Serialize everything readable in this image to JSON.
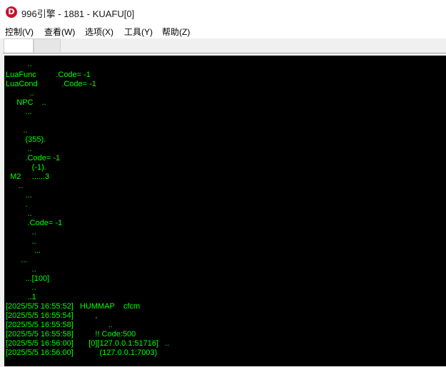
{
  "window": {
    "title": "996引擎 - 1881 - KUAFU[0]",
    "app_icon_letter": "D"
  },
  "menu": [
    {
      "label": "控制(V)"
    },
    {
      "label": "查看(W)"
    },
    {
      "label": "选项(X)"
    },
    {
      "label": "工具(Y)"
    },
    {
      "label": "帮助(Z)"
    }
  ],
  "tabs": [
    {
      "label": ""
    },
    {
      "label": ""
    }
  ],
  "console": {
    "text_color": "#00ff00",
    "background": "#000000",
    "lines": [
      "          ..",
      "LuaFunc         .Code= -1",
      "LuaCond           .Code= -1",
      "           ..",
      "     NPC    ..",
      "         ...",
      "",
      "        ..",
      "         (355).",
      "          ..",
      "         .Code= -1",
      "            (-1).",
      "  M2     ......3",
      "      ..",
      "         ...",
      "         .",
      "          ..",
      "          .Code= -1",
      "            ..",
      "            ..",
      "             ...",
      "       ...",
      "            ..",
      "         ...[100]",
      "            ..",
      "          ..1",
      "[2025/5/5 16:55:52]   HUMMAP    cfcm",
      "[2025/5/5 16:55:54]          ,",
      "[2025/5/5 16:55:58]                ..",
      "[2025/5/5 16:55:58]          !! Code:500",
      "[2025/5/5 16:56:00]       [0][127.0.0.1:51716]   ..",
      "[2025/5/5 16:56:00]            (127.0.0.1:7003)"
    ]
  }
}
